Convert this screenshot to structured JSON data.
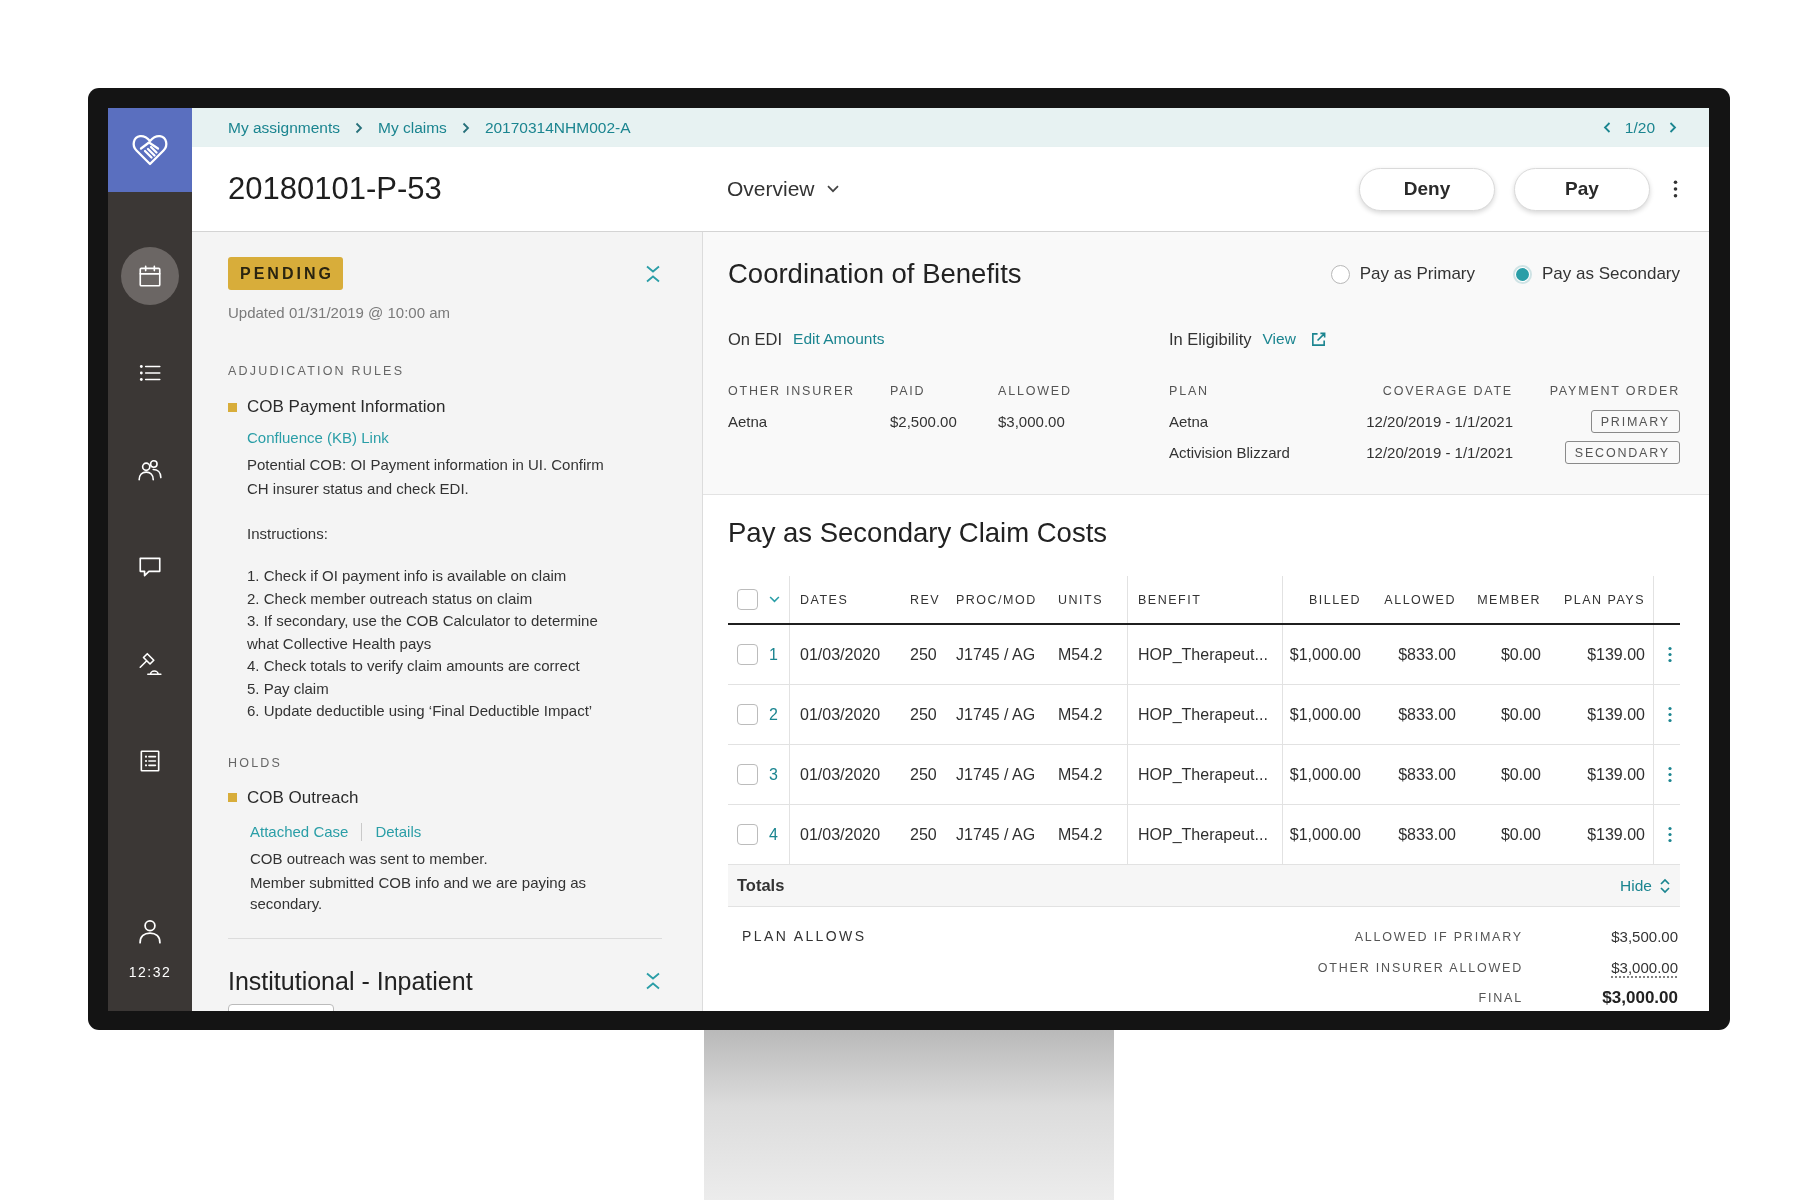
{
  "sidebar": {
    "items": [
      {
        "selected": true
      },
      {
        "selected": false
      },
      {
        "selected": false
      },
      {
        "selected": false
      },
      {
        "selected": false
      },
      {
        "selected": false
      }
    ],
    "clock": "12:32"
  },
  "breadcrumbs": [
    "My assignments",
    "My claims",
    "20170314NHM002-A"
  ],
  "pager": "1/20",
  "header": {
    "title": "20180101-P-53",
    "view_menu": "Overview",
    "buttons": [
      "Deny",
      "Pay"
    ]
  },
  "claim_status": {
    "status": "PENDING",
    "updated": "Updated 01/31/2019 @ 10:00 am"
  },
  "adjudication_rules": {
    "heading": "ADJUDICATION RULES",
    "items": [
      {
        "title": "COB Payment Information",
        "link": "Confluence (KB) Link",
        "description": "Potential COB: OI Payment information in UI. Confirm CH insurer status and check EDI.",
        "instructions_label": "Instructions:",
        "steps": [
          "1. Check if OI payment info is available on claim",
          "2. Check member outreach status on claim",
          "3. If secondary, use the COB Calculator to determine what Collective Health pays",
          "4. Check totals to verify claim amounts are correct",
          "5. Pay claim",
          "6. Update deductible using ‘Final Deductible Impact’"
        ]
      }
    ]
  },
  "holds": {
    "heading": "HOLDS",
    "items": [
      {
        "title": "COB Outreach",
        "links": [
          "Attached Case",
          "Details"
        ],
        "notes": [
          "COB outreach was sent to member.",
          "Member submitted COB info and we are paying as secondary."
        ]
      }
    ]
  },
  "next_section": {
    "title": "Institutional - Inpatient"
  },
  "coordination_of_benefits": {
    "title": "Coordination of Benefits",
    "payment_options": [
      {
        "label": "Pay as Primary",
        "selected": false
      },
      {
        "label": "Pay as Secondary",
        "selected": true
      }
    ],
    "edi": {
      "label": "On EDI",
      "link": "Edit Amounts"
    },
    "eligibility": {
      "label": "In Eligibility",
      "link": "View"
    },
    "other_insurer": {
      "columns": [
        "OTHER INSURER",
        "PAID",
        "ALLOWED"
      ],
      "rows": [
        [
          "Aetna",
          "$2,500.00",
          "$3,000.00"
        ]
      ]
    },
    "plans": {
      "columns": [
        "PLAN",
        "COVERAGE DATE",
        "PAYMENT ORDER"
      ],
      "rows": [
        {
          "plan": "Aetna",
          "coverage_date": "12/20/2019 - 1/1/2021",
          "payment_order": "PRIMARY"
        },
        {
          "plan": "Activision Blizzard",
          "coverage_date": "12/20/2019 - 1/1/2021",
          "payment_order": "SECONDARY"
        }
      ]
    }
  },
  "claim_costs": {
    "title": "Pay as Secondary Claim Costs",
    "select_all_checked": false,
    "columns": [
      "DATES",
      "REV",
      "PROC/MOD",
      "UNITS",
      "BENEFIT",
      "BILLED",
      "ALLOWED",
      "MEMBER",
      "PLAN PAYS"
    ],
    "rows": [
      {
        "line": "1",
        "checked": false,
        "cells": [
          "01/03/2020",
          "250",
          "J1745 / AG",
          "M54.2",
          "HOP_Therapeut...",
          "$1,000.00",
          "$833.00",
          "$0.00",
          "$139.00"
        ]
      },
      {
        "line": "2",
        "checked": false,
        "cells": [
          "01/03/2020",
          "250",
          "J1745 / AG",
          "M54.2",
          "HOP_Therapeut...",
          "$1,000.00",
          "$833.00",
          "$0.00",
          "$139.00"
        ]
      },
      {
        "line": "3",
        "checked": false,
        "cells": [
          "01/03/2020",
          "250",
          "J1745 / AG",
          "M54.2",
          "HOP_Therapeut...",
          "$1,000.00",
          "$833.00",
          "$0.00",
          "$139.00"
        ]
      },
      {
        "line": "4",
        "checked": false,
        "cells": [
          "01/03/2020",
          "250",
          "J1745 / AG",
          "M54.2",
          "HOP_Therapeut...",
          "$1,000.00",
          "$833.00",
          "$0.00",
          "$139.00"
        ]
      }
    ]
  },
  "totals": {
    "label": "Totals",
    "toggle": "Hide",
    "heading": "PLAN ALLOWS",
    "lines": [
      {
        "kind": "plain",
        "label": "ALLOWED IF PRIMARY",
        "value": "$3,500.00"
      },
      {
        "kind": "dotted",
        "label": "OTHER INSURER ALLOWED",
        "value": "$3,000.00"
      },
      {
        "kind": "final",
        "label": "FINAL",
        "value": "$3,000.00"
      }
    ]
  }
}
